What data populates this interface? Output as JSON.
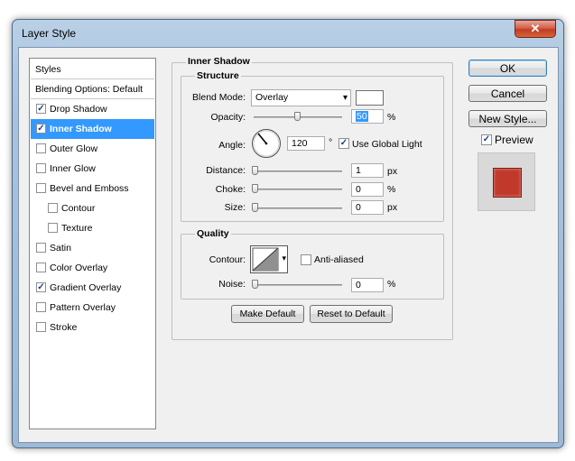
{
  "window": {
    "title": "Layer Style",
    "close_glyph": "✕"
  },
  "styles_list": {
    "items": [
      {
        "label": "Styles",
        "type": "header"
      },
      {
        "label": "Blending Options: Default",
        "type": "header"
      },
      {
        "label": "Drop Shadow",
        "checked": true
      },
      {
        "label": "Inner Shadow",
        "checked": true,
        "selected": true
      },
      {
        "label": "Outer Glow",
        "checked": false
      },
      {
        "label": "Inner Glow",
        "checked": false
      },
      {
        "label": "Bevel and Emboss",
        "checked": false
      },
      {
        "label": "Contour",
        "checked": false,
        "indent": true
      },
      {
        "label": "Texture",
        "checked": false,
        "indent": true
      },
      {
        "label": "Satin",
        "checked": false
      },
      {
        "label": "Color Overlay",
        "checked": false
      },
      {
        "label": "Gradient Overlay",
        "checked": true
      },
      {
        "label": "Pattern Overlay",
        "checked": false
      },
      {
        "label": "Stroke",
        "checked": false
      }
    ]
  },
  "inner_shadow": {
    "title": "Inner Shadow",
    "structure": {
      "title": "Structure",
      "blend_mode_label": "Blend Mode:",
      "blend_mode_value": "Overlay",
      "color": "#ffffff",
      "opacity_label": "Opacity:",
      "opacity_value": "50",
      "opacity_unit": "%",
      "angle_label": "Angle:",
      "angle_value": "120",
      "angle_unit": "°",
      "use_global_light_label": "Use Global Light",
      "use_global_light_checked": true,
      "distance_label": "Distance:",
      "distance_value": "1",
      "distance_unit": "px",
      "choke_label": "Choke:",
      "choke_value": "0",
      "choke_unit": "%",
      "size_label": "Size:",
      "size_value": "0",
      "size_unit": "px"
    },
    "quality": {
      "title": "Quality",
      "contour_label": "Contour:",
      "anti_aliased_label": "Anti-aliased",
      "anti_aliased_checked": false,
      "noise_label": "Noise:",
      "noise_value": "0",
      "noise_unit": "%"
    },
    "make_default_label": "Make Default",
    "reset_default_label": "Reset to Default"
  },
  "buttons": {
    "ok": "OK",
    "cancel": "Cancel",
    "new_style": "New Style...",
    "preview_label": "Preview",
    "preview_checked": true,
    "preview_color": "#c0392b"
  },
  "icons": {
    "check": "✓",
    "dropdown": "▾",
    "close": "close-icon"
  }
}
